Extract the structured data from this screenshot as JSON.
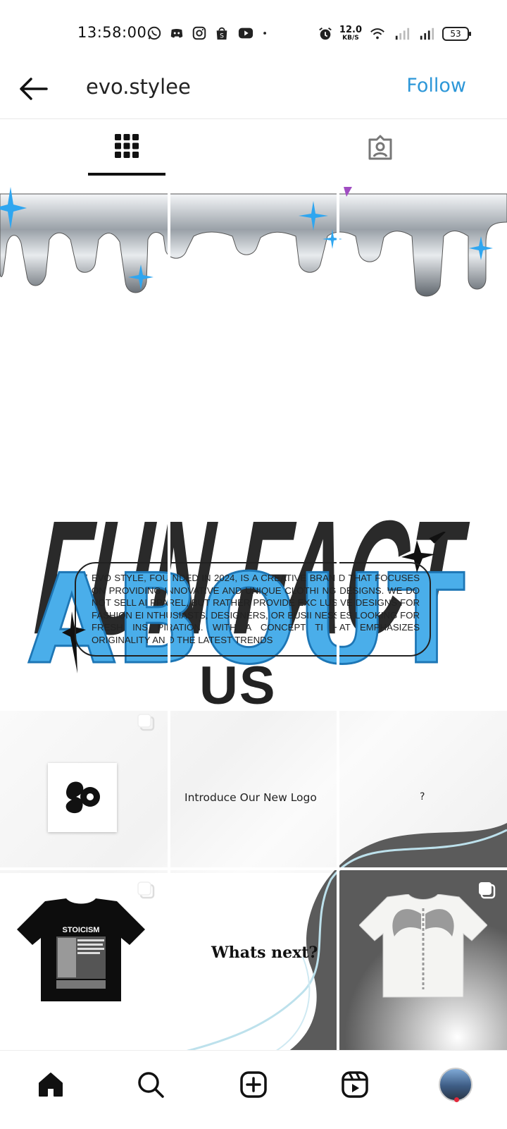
{
  "status_bar": {
    "time": "13:58:00",
    "net_speed_value": "12.0",
    "net_speed_unit": "KB/S",
    "battery": "53",
    "icons": [
      "whatsapp-icon",
      "discord-icon",
      "instagram-icon",
      "shopee-icon",
      "youtube-icon",
      "dot-icon",
      "alarm-icon",
      "wifi-icon",
      "signal-icon",
      "signal-icon",
      "battery-icon"
    ]
  },
  "header": {
    "username": "evo.stylee",
    "follow_label": "Follow"
  },
  "tabs": [
    {
      "name": "posts-grid",
      "icon": "grid-icon",
      "active": true
    },
    {
      "name": "tagged",
      "icon": "tagged-person-icon",
      "active": false
    }
  ],
  "post_about": {
    "headline_top": "FUN FACT",
    "headline_main": "ABOUT",
    "headline_sub": "US",
    "body": "EVO STYLE, FOU NDED IN 2024, IS A CREATIVE BRAN D THAT FOCUSES ON PROVIDING INNOVATIVE AND UNIQUE CLOTHI NG DESIGNS. WE DO NOT SELL AI PPAREL, BUT RATHER PROVIDE EXC LUSIVE DESIGNS FOR FASHION EI NTHUSIASTS, DESIGNERS, OR BUSII NESSES LOOKING FOR FRESH INS PIRATION. WITH A CONCEPT TI HAT EMPHASIZES ORIGINALITY AN D THE LATEST TRENDS"
  },
  "post_logo": {
    "intro_text": "Introduce Our New Logo",
    "question": "?"
  },
  "post_next": {
    "shirt_label": "STOICISM",
    "whats_next": "Whats next?"
  },
  "bottom_nav": [
    {
      "name": "home",
      "icon": "home-icon"
    },
    {
      "name": "search",
      "icon": "search-icon"
    },
    {
      "name": "create",
      "icon": "add-post-icon"
    },
    {
      "name": "reels",
      "icon": "reels-icon"
    },
    {
      "name": "profile",
      "icon": "profile-avatar-icon"
    }
  ],
  "colors": {
    "follow": "#2d97d8",
    "bubble_blue": "#4aaeea",
    "notification_dot": "#e2283b"
  }
}
